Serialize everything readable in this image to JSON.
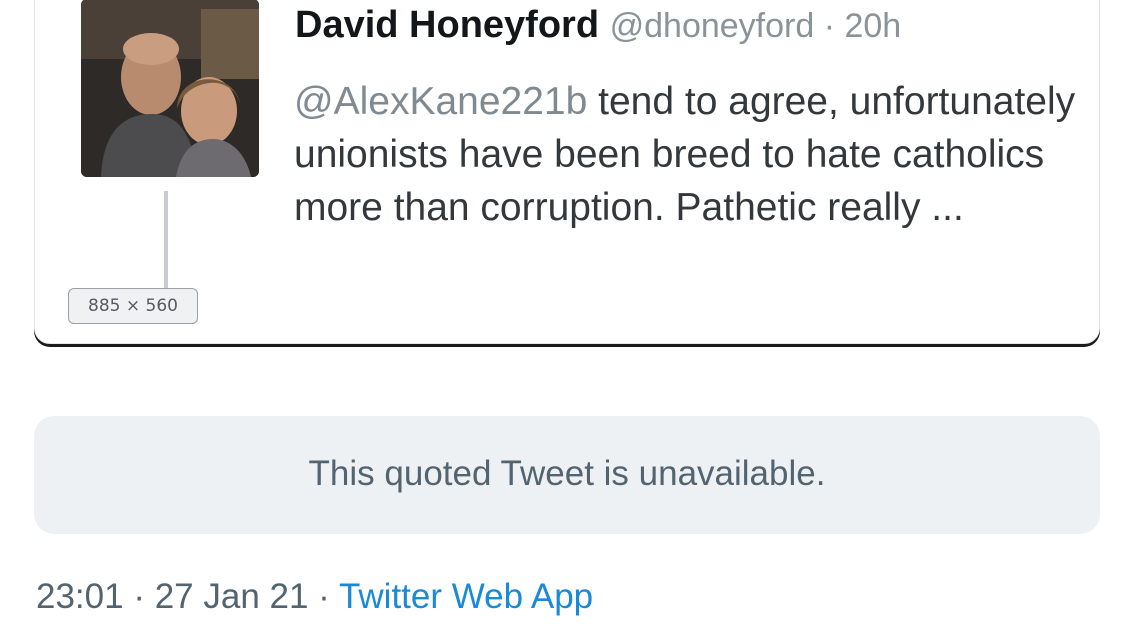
{
  "embedded_tweet": {
    "author_name": "David Honeyford",
    "author_handle": "@dhoneyford",
    "separator": " · ",
    "time_ago": "20h",
    "mention": "@AlexKane221b",
    "body_text": " tend to agree, unfortunately unionists have been breed to hate catholics more than corruption. Pathetic really ...",
    "image_size_badge": "885 × 560"
  },
  "quoted_tweet": {
    "notice": "This quoted Tweet is unavailable."
  },
  "meta": {
    "time": "23:01",
    "separator": " · ",
    "date": "27 Jan 21",
    "source": "Twitter Web App"
  },
  "colors": {
    "link_blue": "#1b8ad6",
    "muted_text": "#536471",
    "quoted_bg": "#eef1f4"
  }
}
